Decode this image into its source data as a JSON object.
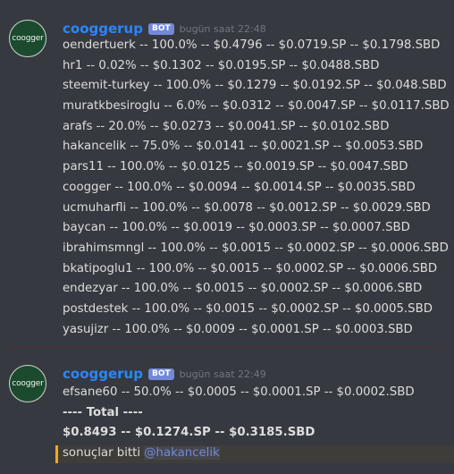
{
  "messages": [
    {
      "avatar_text": "coogger",
      "username": "cooggerup",
      "badge": "BOT",
      "timestamp": "bugün saat 22:48",
      "lines": [
        "oendertuerk -- 100.0% -- $0.4796 -- $0.0719.SP -- $0.1798.SBD",
        "hr1 -- 0.02% -- $0.1302 -- $0.0195.SP -- $0.0488.SBD",
        "steemit-turkey -- 100.0% -- $0.1279 -- $0.0192.SP -- $0.048.SBD",
        "muratkbesiroglu -- 6.0% -- $0.0312 -- $0.0047.SP -- $0.0117.SBD",
        "arafs -- 20.0% -- $0.0273 -- $0.0041.SP -- $0.0102.SBD",
        "hakancelik -- 75.0% -- $0.0141 -- $0.0021.SP -- $0.0053.SBD",
        "pars11 -- 100.0% -- $0.0125 -- $0.0019.SP -- $0.0047.SBD",
        "coogger -- 100.0% -- $0.0094 -- $0.0014.SP -- $0.0035.SBD",
        "ucmuharfli -- 100.0% -- $0.0078 -- $0.0012.SP -- $0.0029.SBD",
        "baycan -- 100.0% -- $0.0019 -- $0.0003.SP -- $0.0007.SBD",
        "ibrahimsmngl -- 100.0% -- $0.0015 -- $0.0002.SP -- $0.0006.SBD",
        "bkatipoglu1 -- 100.0% -- $0.0015 -- $0.0002.SP -- $0.0006.SBD",
        "endezyar -- 100.0% -- $0.0015 -- $0.0002.SP -- $0.0006.SBD",
        "postdestek -- 100.0% -- $0.0015 -- $0.0002.SP -- $0.0005.SBD",
        "yasujizr -- 100.0% -- $0.0009 -- $0.0001.SP -- $0.0003.SBD"
      ]
    },
    {
      "avatar_text": "coogger",
      "username": "cooggerup",
      "badge": "BOT",
      "timestamp": "bugün saat 22:49",
      "lines": [
        "efsane60 -- 50.0% -- $0.0005 -- $0.0001.SP -- $0.0002.SBD"
      ],
      "total_header": "---- Total ----",
      "total_values": "$0.8493  --  $0.1274.SP  --  $0.3185.SBD",
      "final_text": "sonuçlar bitti ",
      "mention": "@hakancelik"
    }
  ]
}
